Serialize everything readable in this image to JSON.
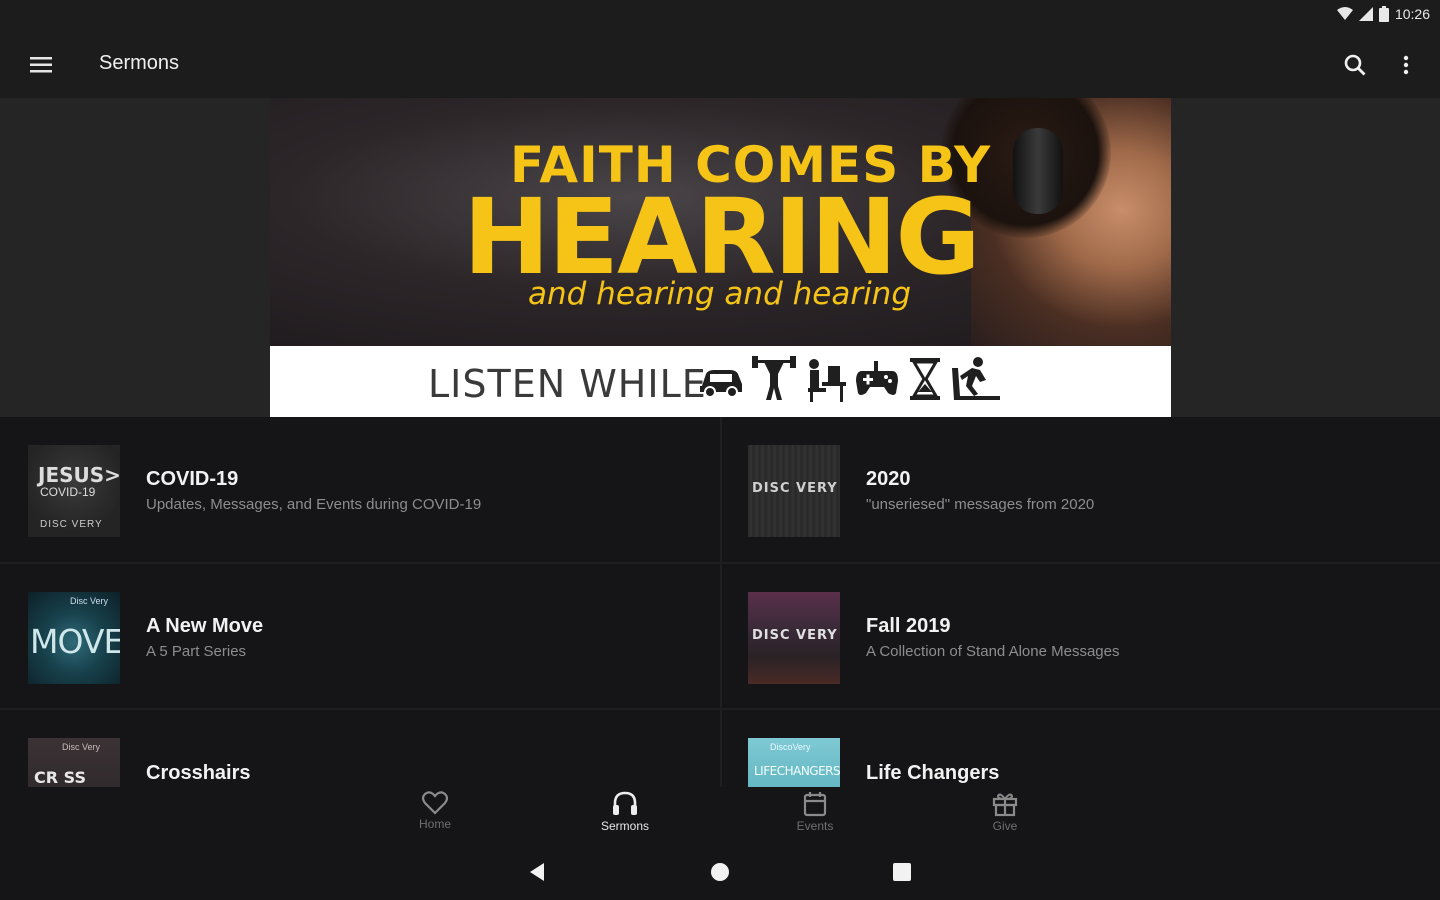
{
  "status_bar": {
    "time": "10:26",
    "icons": [
      "wifi-icon",
      "signal-icon",
      "battery-icon"
    ]
  },
  "app_bar": {
    "title": "Sermons",
    "menu_icon": "hamburger-icon",
    "search_icon": "search-icon",
    "more_icon": "overflow-menu-icon"
  },
  "banner": {
    "line1": "FAITH COMES BY",
    "line2": "HEARING",
    "line3": "and hearing and hearing",
    "strip_text": "LISTEN WHILE",
    "activity_icons": [
      "car-icon",
      "weightlifting-icon",
      "office-work-icon",
      "gamepad-icon",
      "hourglass-icon",
      "treadmill-icon"
    ],
    "accent_color": "#f5c416"
  },
  "series": [
    {
      "title": "COVID-19",
      "subtitle": "Updates, Messages, and Events during COVID-19",
      "thumb_text": [
        "JESUS>",
        "COVID-19",
        "DISC VERY"
      ]
    },
    {
      "title": "2020",
      "subtitle": "\"unseriesed\" messages from 2020",
      "thumb_text": [
        "DISC VERY"
      ]
    },
    {
      "title": "A New Move",
      "subtitle": "A 5 Part Series",
      "thumb_text": [
        "MOVE",
        "Disc Very"
      ]
    },
    {
      "title": "Fall 2019",
      "subtitle": "A Collection of Stand Alone Messages",
      "thumb_text": [
        "DISC VERY"
      ]
    },
    {
      "title": "Crosshairs",
      "subtitle": "",
      "thumb_text": [
        "CR  SS",
        "Disc Very"
      ]
    },
    {
      "title": "Life Changers",
      "subtitle": "",
      "thumb_text": [
        "LIFECHANGERS",
        "DiscoVery"
      ]
    }
  ],
  "bottom_nav": [
    {
      "label": "Home",
      "icon": "heart-icon",
      "active": false
    },
    {
      "label": "Sermons",
      "icon": "headphones-icon",
      "active": true
    },
    {
      "label": "Events",
      "icon": "calendar-icon",
      "active": false
    },
    {
      "label": "Give",
      "icon": "gift-icon",
      "active": false
    }
  ],
  "system_nav": [
    "back-icon",
    "home-icon",
    "recents-icon"
  ]
}
